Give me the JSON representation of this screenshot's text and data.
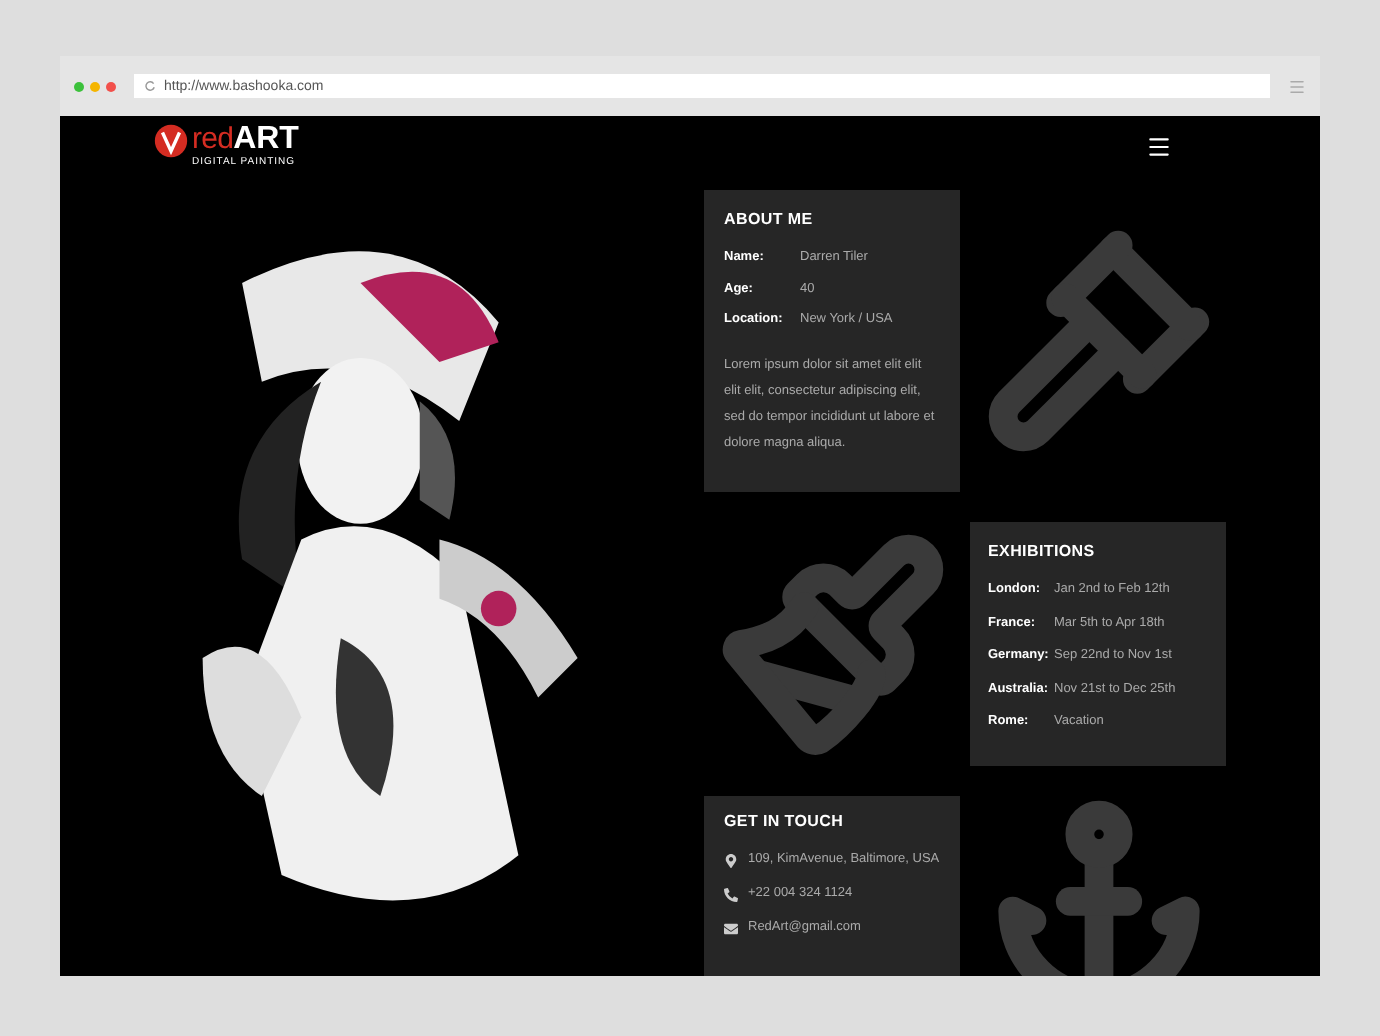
{
  "browser": {
    "url": "http://www.bashooka.com"
  },
  "header": {
    "logo_script": "red",
    "logo_bold": "ART",
    "logo_tagline": "DIGITAL PAINTING"
  },
  "about": {
    "title": "ABOUT ME",
    "fields": [
      {
        "label": "Name:",
        "value": "Darren Tiler"
      },
      {
        "label": "Age:",
        "value": "40"
      },
      {
        "label": "Location:",
        "value": "New York / USA"
      }
    ],
    "text": "Lorem ipsum dolor sit amet elit elit elit elit, consectetur adipiscing elit, sed do tempor incididunt ut labore et dolore magna aliqua."
  },
  "exhibitions": {
    "title": "EXHIBITIONS",
    "items": [
      {
        "place": "London:",
        "dates": "Jan 2nd to Feb 12th"
      },
      {
        "place": "France:",
        "dates": "Mar 5th to Apr 18th"
      },
      {
        "place": "Germany:",
        "dates": "Sep 22nd to Nov 1st"
      },
      {
        "place": "Australia:",
        "dates": "Nov 21st to Dec 25th"
      },
      {
        "place": "Rome:",
        "dates": "Vacation"
      }
    ]
  },
  "contact": {
    "title": "GET IN TOUCH",
    "items": [
      {
        "kind": "address",
        "text": "109, KimAvenue, Baltimore, USA"
      },
      {
        "kind": "phone",
        "text": "+22 004 324 1124"
      },
      {
        "kind": "email",
        "text": "RedArt@gmail.com"
      }
    ]
  }
}
